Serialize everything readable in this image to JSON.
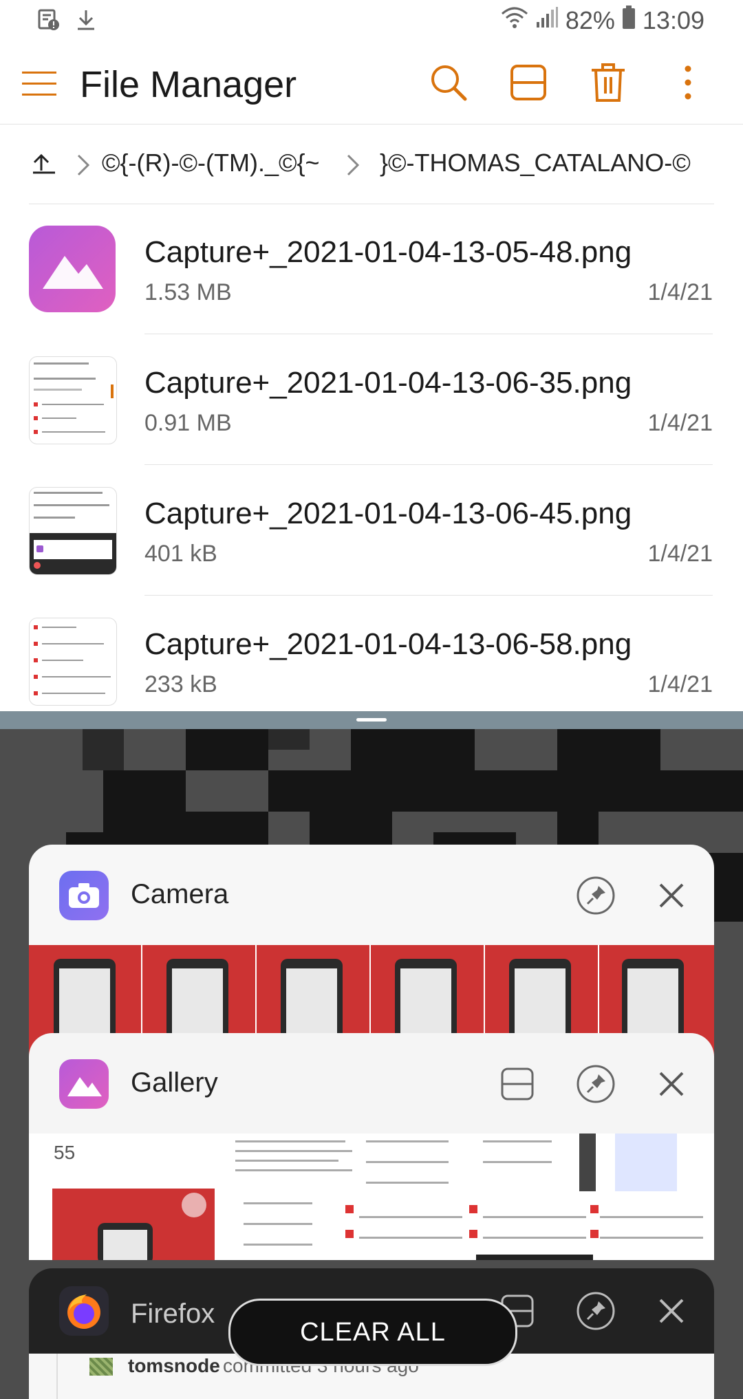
{
  "status_bar": {
    "battery": "82%",
    "time": "13:09",
    "icons": [
      "sim-alert-icon",
      "download-icon",
      "wifi-icon",
      "signal-icon",
      "battery-icon"
    ]
  },
  "app_bar": {
    "title": "File Manager",
    "actions": [
      "search-icon",
      "view-layout-icon",
      "delete-icon",
      "more-icon"
    ],
    "accent_color": "#d9730d"
  },
  "breadcrumb": {
    "segments": [
      "©{-(R)-©-(TM)._©{~",
      "}©-THOMAS_CATALANO-©"
    ]
  },
  "files": [
    {
      "name": "Capture+_2021-01-04-13-05-48.png",
      "size": "1.53 MB",
      "date": "1/4/21"
    },
    {
      "name": "Capture+_2021-01-04-13-06-35.png",
      "size": "0.91 MB",
      "date": "1/4/21"
    },
    {
      "name": "Capture+_2021-01-04-13-06-45.png",
      "size": "401 kB",
      "date": "1/4/21"
    },
    {
      "name": "Capture+_2021-01-04-13-06-58.png",
      "size": "233 kB",
      "date": "1/4/21"
    }
  ],
  "recent_apps": {
    "camera": {
      "label": "Camera"
    },
    "gallery": {
      "label": "Gallery",
      "count": "55"
    },
    "firefox": {
      "label": "Firefox",
      "commit_user": "tomsnode",
      "commit_text": "committed 3 hours ago"
    },
    "clear_all": "CLEAR ALL"
  }
}
